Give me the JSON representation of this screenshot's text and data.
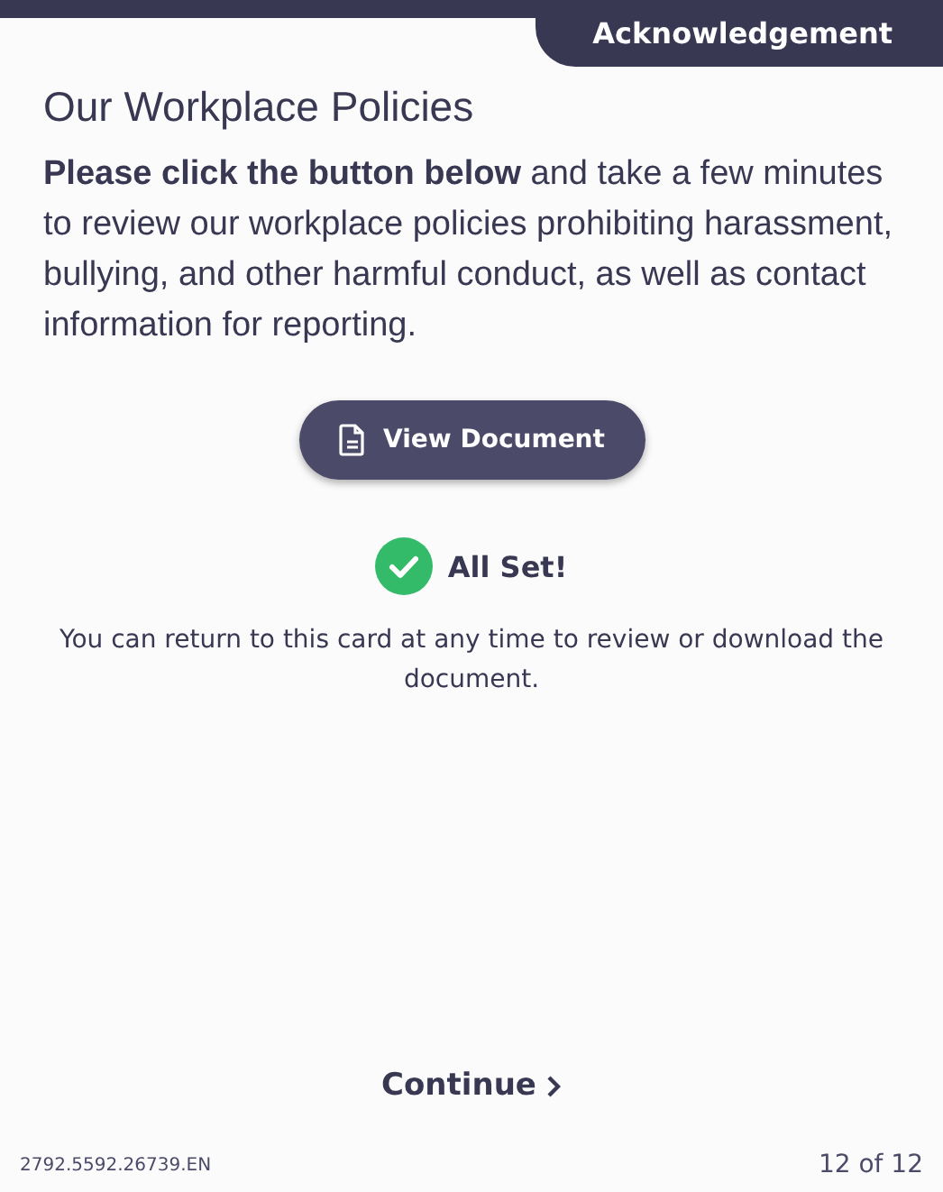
{
  "header": {
    "tab": "Acknowledgement"
  },
  "title": "Our Workplace Policies",
  "intro": "**Please click the button below** and take a few minutes to review our workplace policies prohibiting harassment, bullying, and other harmful conduct, as well as contact information for reporting.",
  "document_button": "View Document",
  "status": {
    "done": true,
    "label": "All Set!"
  },
  "note": "You can return to this card at any time to review or download the document.",
  "continue": "Continue",
  "footer": {
    "code": "2792.5592.26739.EN",
    "page": "12 of 12"
  }
}
